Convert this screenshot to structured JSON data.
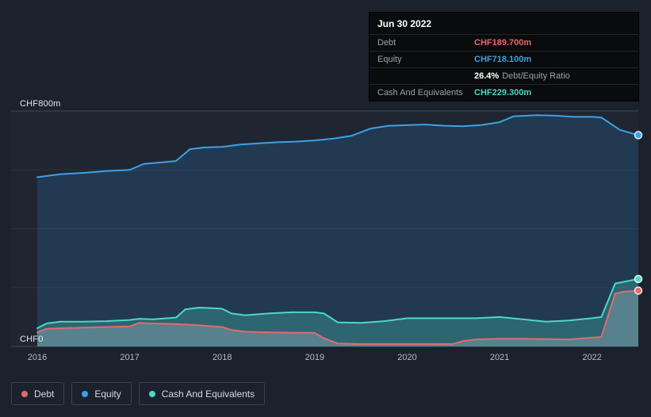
{
  "colors": {
    "background": "#1b222d",
    "debt": "#e06c6c",
    "equity": "#3ca1e6",
    "cash": "#4fd6c7",
    "grid_major": "#3e4956",
    "tooltip_background": "#0a0b0c"
  },
  "axis": {
    "y_top": "CHF800m",
    "y_zero": "CHF0"
  },
  "tooltip": {
    "date": "Jun 30 2022",
    "debt_label": "Debt",
    "debt_value": "CHF189.700m",
    "equity_label": "Equity",
    "equity_value": "CHF718.100m",
    "ratio_value": "26.4%",
    "ratio_suffix": "Debt/Equity Ratio",
    "cash_label": "Cash And Equivalents",
    "cash_value": "CHF229.300m"
  },
  "legend": {
    "debt": "Debt",
    "equity": "Equity",
    "cash": "Cash And Equivalents"
  },
  "chart_data": {
    "type": "area",
    "units": "CHF millions",
    "xlim": [
      2016,
      2022.5
    ],
    "ylim": [
      0,
      800
    ],
    "y_gridlines": [
      0,
      200,
      400,
      600,
      800
    ],
    "x_ticks": [
      {
        "value": 2016,
        "label": "2016"
      },
      {
        "value": 2017,
        "label": "2017"
      },
      {
        "value": 2018,
        "label": "2018"
      },
      {
        "value": 2019,
        "label": "2019"
      },
      {
        "value": 2020,
        "label": "2020"
      },
      {
        "value": 2021,
        "label": "2021"
      },
      {
        "value": 2022,
        "label": "2022"
      }
    ],
    "legend_position": "bottom-left",
    "series": [
      {
        "name": "Equity",
        "color": "#3ca1e6",
        "fill": "rgba(46,142,210,0.20)",
        "points": [
          [
            2016.0,
            575
          ],
          [
            2016.25,
            585
          ],
          [
            2016.5,
            590
          ],
          [
            2016.75,
            596
          ],
          [
            2017.0,
            600
          ],
          [
            2017.15,
            620
          ],
          [
            2017.3,
            624
          ],
          [
            2017.5,
            630
          ],
          [
            2017.65,
            670
          ],
          [
            2017.8,
            676
          ],
          [
            2018.0,
            678
          ],
          [
            2018.2,
            686
          ],
          [
            2018.4,
            690
          ],
          [
            2018.6,
            694
          ],
          [
            2018.8,
            696
          ],
          [
            2019.0,
            700
          ],
          [
            2019.2,
            706
          ],
          [
            2019.4,
            716
          ],
          [
            2019.6,
            740
          ],
          [
            2019.8,
            750
          ],
          [
            2020.0,
            752
          ],
          [
            2020.2,
            754
          ],
          [
            2020.4,
            750
          ],
          [
            2020.6,
            748
          ],
          [
            2020.8,
            752
          ],
          [
            2021.0,
            762
          ],
          [
            2021.15,
            782
          ],
          [
            2021.4,
            786
          ],
          [
            2021.6,
            784
          ],
          [
            2021.8,
            780
          ],
          [
            2022.0,
            780
          ],
          [
            2022.1,
            778
          ],
          [
            2022.3,
            736
          ],
          [
            2022.5,
            718.1
          ]
        ]
      },
      {
        "name": "Cash And Equivalents",
        "color": "#4fd6c7",
        "fill": "rgba(79,214,199,0.28)",
        "points": [
          [
            2016.0,
            62
          ],
          [
            2016.1,
            78
          ],
          [
            2016.25,
            84
          ],
          [
            2016.5,
            84
          ],
          [
            2016.75,
            86
          ],
          [
            2017.0,
            90
          ],
          [
            2017.1,
            94
          ],
          [
            2017.25,
            92
          ],
          [
            2017.5,
            98
          ],
          [
            2017.6,
            126
          ],
          [
            2017.75,
            132
          ],
          [
            2017.9,
            130
          ],
          [
            2018.0,
            128
          ],
          [
            2018.1,
            112
          ],
          [
            2018.25,
            106
          ],
          [
            2018.5,
            112
          ],
          [
            2018.75,
            116
          ],
          [
            2019.0,
            116
          ],
          [
            2019.1,
            112
          ],
          [
            2019.25,
            82
          ],
          [
            2019.5,
            80
          ],
          [
            2019.75,
            86
          ],
          [
            2020.0,
            96
          ],
          [
            2020.25,
            96
          ],
          [
            2020.5,
            96
          ],
          [
            2020.75,
            96
          ],
          [
            2021.0,
            100
          ],
          [
            2021.25,
            92
          ],
          [
            2021.5,
            84
          ],
          [
            2021.75,
            88
          ],
          [
            2022.0,
            96
          ],
          [
            2022.1,
            100
          ],
          [
            2022.25,
            214
          ],
          [
            2022.5,
            229.3
          ]
        ]
      },
      {
        "name": "Debt",
        "color": "#e06c6c",
        "fill": "rgba(206,214,224,0.26)",
        "points": [
          [
            2016.0,
            48
          ],
          [
            2016.1,
            60
          ],
          [
            2016.25,
            62
          ],
          [
            2016.5,
            64
          ],
          [
            2016.75,
            66
          ],
          [
            2017.0,
            68
          ],
          [
            2017.1,
            80
          ],
          [
            2017.25,
            78
          ],
          [
            2017.5,
            76
          ],
          [
            2017.75,
            72
          ],
          [
            2018.0,
            66
          ],
          [
            2018.1,
            56
          ],
          [
            2018.25,
            50
          ],
          [
            2018.5,
            48
          ],
          [
            2018.75,
            47
          ],
          [
            2019.0,
            46
          ],
          [
            2019.1,
            28
          ],
          [
            2019.25,
            10
          ],
          [
            2019.5,
            8
          ],
          [
            2019.75,
            8
          ],
          [
            2020.0,
            8
          ],
          [
            2020.25,
            8
          ],
          [
            2020.5,
            9
          ],
          [
            2020.6,
            18
          ],
          [
            2020.75,
            24
          ],
          [
            2021.0,
            26
          ],
          [
            2021.25,
            26
          ],
          [
            2021.5,
            25
          ],
          [
            2021.75,
            24
          ],
          [
            2022.0,
            30
          ],
          [
            2022.1,
            32
          ],
          [
            2022.25,
            180
          ],
          [
            2022.35,
            186
          ],
          [
            2022.5,
            189.7
          ]
        ]
      }
    ]
  }
}
